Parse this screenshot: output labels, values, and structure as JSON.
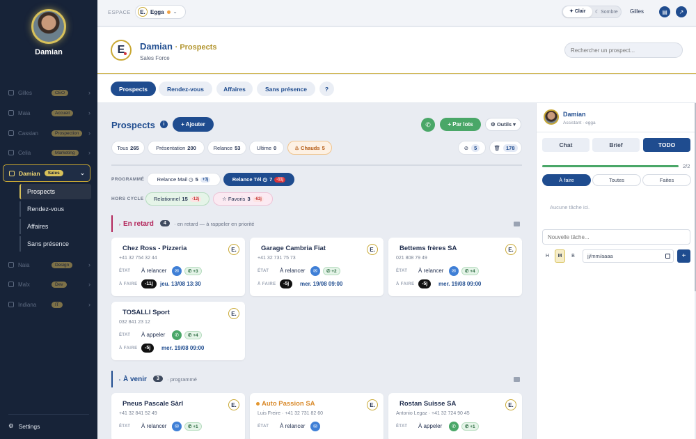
{
  "sidebar": {
    "user_name": "Damian",
    "items": [
      {
        "label": "Gilles",
        "badge": "CEO"
      },
      {
        "label": "Maia",
        "badge": "Accueil"
      },
      {
        "label": "Cassian",
        "badge": "Prospection"
      },
      {
        "label": "Celia",
        "badge": "Marketing"
      },
      {
        "label": "Damian",
        "badge": "Sales"
      },
      {
        "label": "Naia",
        "badge": "Design"
      },
      {
        "label": "Malx",
        "badge": "Dev"
      },
      {
        "label": "Indiana",
        "badge": "IT"
      }
    ],
    "sub_items": [
      "Prospects",
      "Rendez-vous",
      "Affaires",
      "Sans présence"
    ],
    "settings": "Settings"
  },
  "topbar": {
    "espace_label": "ESPACE",
    "espace_name": "Egga",
    "theme_light": "✦ Clair",
    "theme_dark": "☾ Sombre",
    "user": "Gilles"
  },
  "header": {
    "name": "Damian",
    "section": "· Prospects",
    "subtitle": "Sales Force",
    "search_placeholder": "Rechercher un prospect..."
  },
  "tabs": [
    "Prospects",
    "Rendez-vous",
    "Affaires",
    "Sans présence",
    "?"
  ],
  "main": {
    "title": "Prospects",
    "add_button": "+ Ajouter",
    "lots_button": "+ Par lots",
    "outils_button": "⚙ Outils ▾",
    "filters": [
      {
        "label": "Tous",
        "count": "265"
      },
      {
        "label": "Présentation",
        "count": "200"
      },
      {
        "label": "Relance",
        "count": "53"
      },
      {
        "label": "Ultime",
        "count": "0"
      },
      {
        "label": "♨ Chauds",
        "count": "5"
      }
    ],
    "blocked_count": "5",
    "trash_count": "178",
    "programme_label": "PROGRAMMÉ",
    "programme_chips": [
      {
        "label": "Relance Mail ◷",
        "count": "5",
        "badge": "+3j"
      },
      {
        "label": "Relance Tél ◷",
        "count": "7",
        "badge": "-11j"
      }
    ],
    "hors_cycle_label": "HORS CYCLE",
    "hors_cycle_chips": [
      {
        "label": "Relationnel",
        "count": "15",
        "badge": "-12j"
      },
      {
        "label": "☆ Favoris",
        "count": "3",
        "badge": "-62j"
      }
    ],
    "sections": [
      {
        "title": "En retard",
        "count": "4",
        "desc": "· en retard — à rappeler en priorité"
      },
      {
        "title": "À venir",
        "count": "3",
        "desc": "· programmé"
      }
    ],
    "card_labels": {
      "etat": "ÉTAT",
      "faire": "À FAIRE"
    },
    "late_cards": [
      {
        "name": "Chez Ross - Pizzeria",
        "phone": "+41 32 754 32 44",
        "etat": "À relancer",
        "plus": "+3",
        "delay": "-11j",
        "date": "jeu. 13/08 13:30"
      },
      {
        "name": "Garage Cambria Fiat",
        "phone": "+41 32 731 75 73",
        "etat": "À relancer",
        "plus": "+2",
        "delay": "-5j",
        "date": "mer. 19/08 09:00"
      },
      {
        "name": "Bettems frères SA",
        "phone": "021 808 79 49",
        "etat": "À relancer",
        "plus": "+4",
        "delay": "-5j",
        "date": "mer. 19/08 09:00"
      },
      {
        "name": "TOSALLI Sport",
        "phone": "032 841 23 12",
        "etat": "À appeler",
        "plus": "+4",
        "delay": "-5j",
        "date": "mer. 19/08 09:00"
      }
    ],
    "upcoming_cards": [
      {
        "name": "Pneus Pascale Sàrl",
        "phone": "+41 32 841 52 49",
        "etat": "À relancer",
        "plus": "+1"
      },
      {
        "name": "Auto Passion SA",
        "phone": "Luis Freire · +41 32 731 82 60",
        "etat": "À relancer"
      },
      {
        "name": "Rostan Suisse SA",
        "phone": "Antonio Legaz · +41 32 724 90 45",
        "etat": "À appeler",
        "plus": "+1"
      }
    ]
  },
  "panel": {
    "name": "Damian",
    "role": "Assistant · egga",
    "tabs": [
      "Chat",
      "Brief",
      "TODO"
    ],
    "progress_text": "2/2",
    "progress_fraction": 1.0,
    "segments": [
      "À faire",
      "Toutes",
      "Faites"
    ],
    "empty": "Aucune tâche ici.",
    "new_task_placeholder": "Nouvelle tâche...",
    "priorities": [
      "H",
      "M",
      "B"
    ],
    "date_placeholder": "jj/mm/aaaa",
    "add": "+"
  }
}
